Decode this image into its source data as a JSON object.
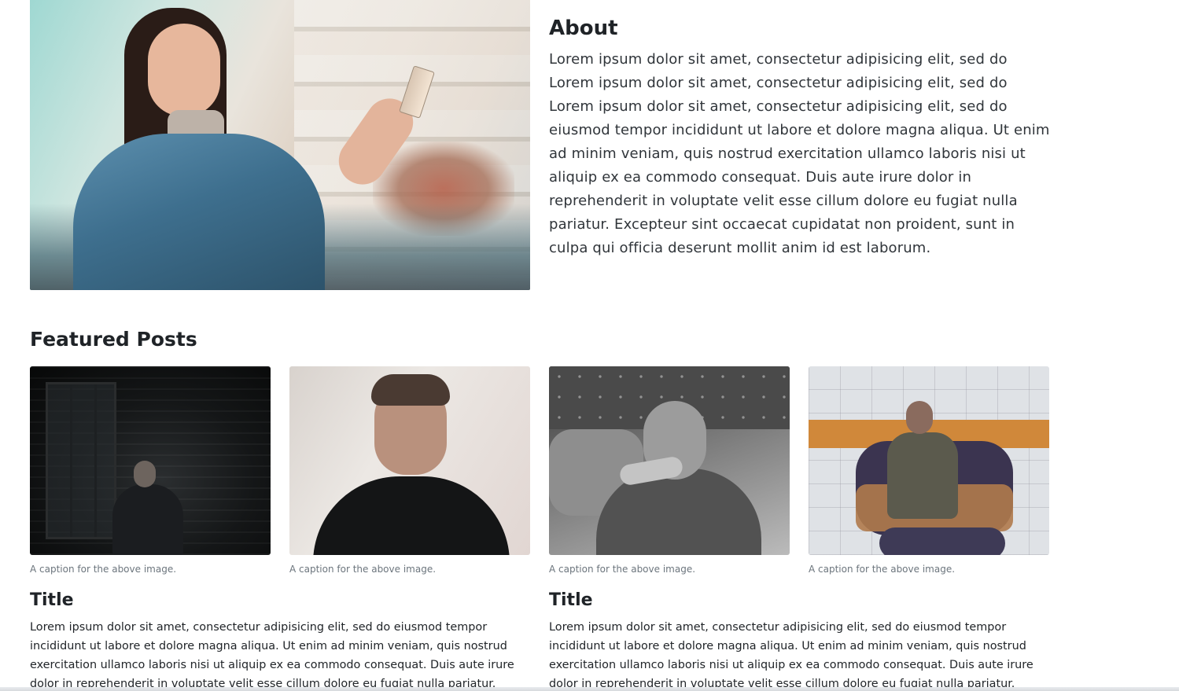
{
  "about": {
    "title": "About",
    "body": "Lorem ipsum dolor sit amet, consectetur adipisicing elit, sed do Lorem ipsum dolor sit amet, consectetur adipisicing elit, sed do Lorem ipsum dolor sit amet, consectetur adipisicing elit, sed do eiusmod tempor incididunt ut labore et dolore magna aliqua. Ut enim ad minim veniam, quis nostrud exercitation ullamco laboris nisi ut aliquip ex ea commodo consequat. Duis aute irure dolor in reprehenderit in voluptate velit esse cillum dolore eu fugiat nulla pariatur. Excepteur sint occaecat cupidatat non proident, sunt in culpa qui officia deserunt mollit anim id est laborum."
  },
  "featured": {
    "title": "Featured Posts",
    "captions": [
      "A caption for the above image.",
      "A caption for the above image.",
      "A caption for the above image.",
      "A caption for the above image."
    ]
  },
  "posts": [
    {
      "title": "Title",
      "body": "Lorem ipsum dolor sit amet, consectetur adipisicing elit, sed do eiusmod tempor incididunt ut labore et dolore magna aliqua. Ut enim ad minim veniam, quis nostrud exercitation ullamco laboris nisi ut aliquip ex ea commodo consequat. Duis aute irure dolor in reprehenderit in voluptate velit esse cillum dolore eu fugiat nulla pariatur."
    },
    {
      "title": "Title",
      "body": "Lorem ipsum dolor sit amet, consectetur adipisicing elit, sed do eiusmod tempor incididunt ut labore et dolore magna aliqua. Ut enim ad minim veniam, quis nostrud exercitation ullamco laboris nisi ut aliquip ex ea commodo consequat. Duis aute irure dolor in reprehenderit in voluptate velit esse cillum dolore eu fugiat nulla pariatur."
    }
  ]
}
